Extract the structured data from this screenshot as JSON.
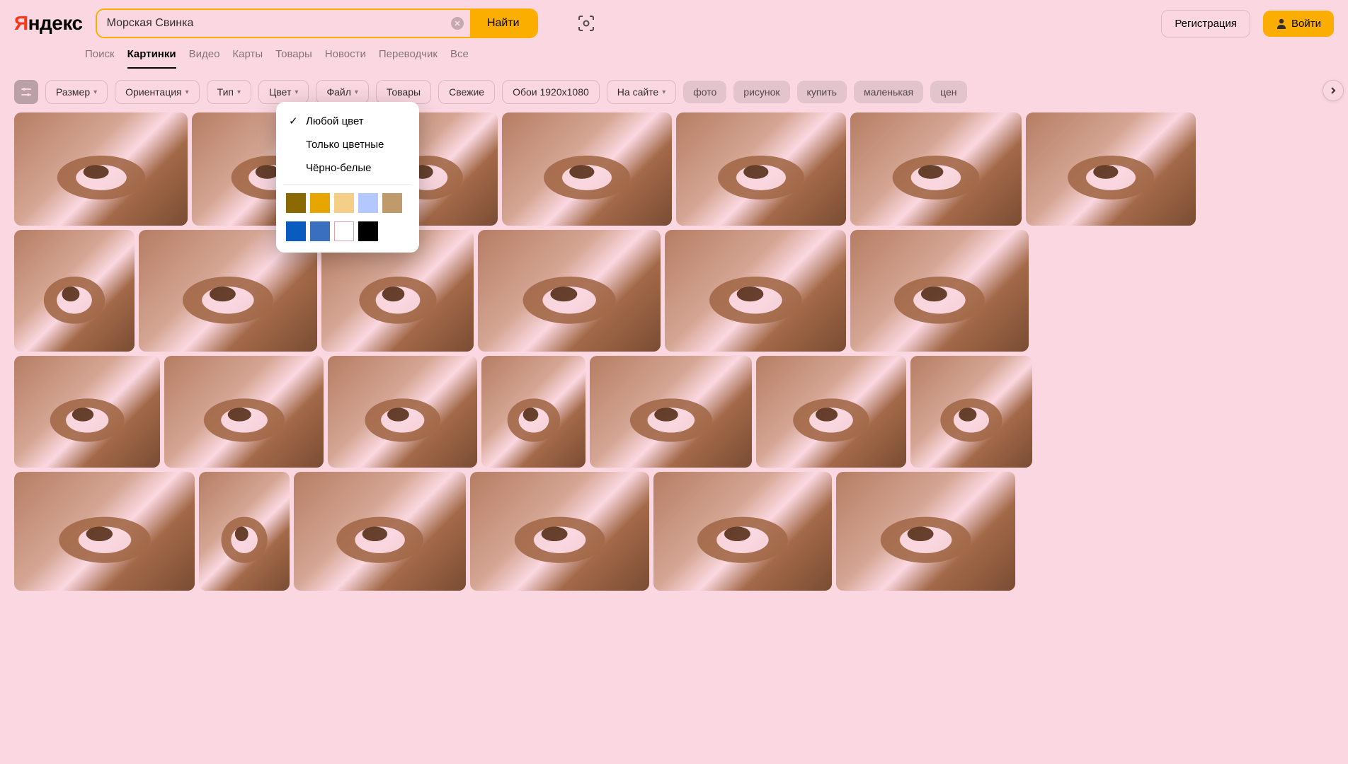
{
  "logo": {
    "prefix": "Я",
    "rest": "ндекс"
  },
  "search": {
    "value": "Морская Свинка",
    "button": "Найти"
  },
  "register": "Регистрация",
  "login": "Войти",
  "tabs": [
    {
      "label": "Поиск",
      "active": false
    },
    {
      "label": "Картинки",
      "active": true
    },
    {
      "label": "Видео",
      "active": false
    },
    {
      "label": "Карты",
      "active": false
    },
    {
      "label": "Товары",
      "active": false
    },
    {
      "label": "Новости",
      "active": false
    },
    {
      "label": "Переводчик",
      "active": false
    },
    {
      "label": "Все",
      "active": false
    }
  ],
  "filters": [
    {
      "label": "Размер",
      "dropdown": true
    },
    {
      "label": "Ориентация",
      "dropdown": true
    },
    {
      "label": "Тип",
      "dropdown": true
    },
    {
      "label": "Цвет",
      "dropdown": true
    },
    {
      "label": "Файл",
      "dropdown": true
    },
    {
      "label": "Товары",
      "dropdown": false
    },
    {
      "label": "Свежие",
      "dropdown": false
    },
    {
      "label": "Обои 1920x1080",
      "dropdown": false
    },
    {
      "label": "На сайте",
      "dropdown": true
    }
  ],
  "tags": [
    "фото",
    "рисунок",
    "купить",
    "маленькая",
    "цен"
  ],
  "colorPopup": {
    "options": [
      {
        "label": "Любой цвет",
        "selected": true
      },
      {
        "label": "Только цветные",
        "selected": false
      },
      {
        "label": "Чёрно-белые",
        "selected": false
      }
    ],
    "swatches": [
      [
        "#8a6a00",
        "#e6a500",
        "#f5cf88",
        "#b3c8ff",
        "#bf9a6a"
      ],
      [
        "#0a5bbf",
        "#3a6fbf",
        "#ffffff",
        "#000000"
      ]
    ]
  },
  "gallery_rows": [
    [
      245,
      226,
      200,
      240,
      240,
      242,
      240
    ],
    [
      170,
      252,
      215,
      258,
      256,
      252
    ],
    [
      206,
      225,
      211,
      147,
      229,
      212,
      172
    ],
    [
      255,
      128,
      243,
      253,
      252,
      253
    ]
  ],
  "gallery_heights": [
    160,
    172,
    158,
    168
  ]
}
